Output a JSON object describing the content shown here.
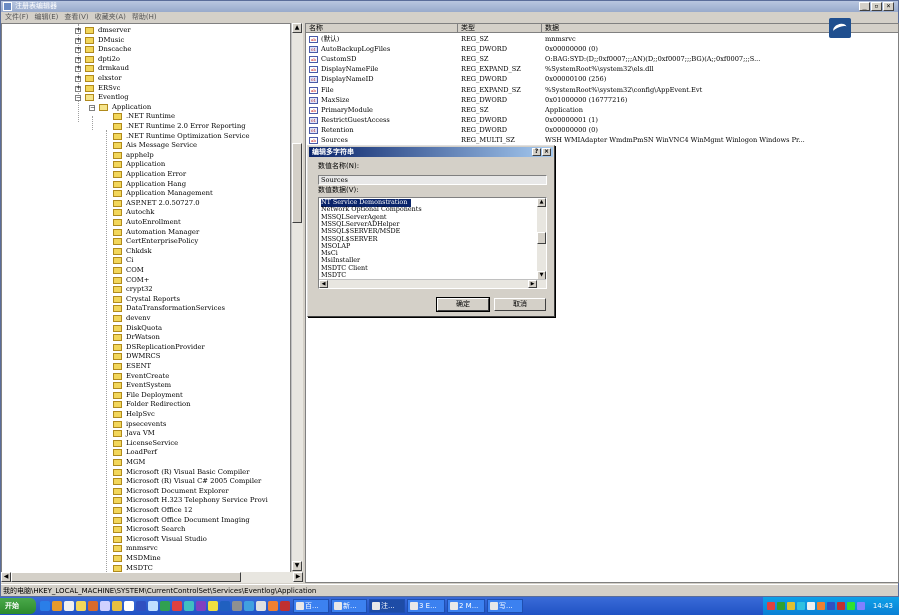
{
  "window": {
    "title": "注册表编辑器",
    "controls": [
      "_",
      "▫",
      "×"
    ]
  },
  "menu": [
    "文件(F)",
    "编辑(E)",
    "查看(V)",
    "收藏夹(A)",
    "帮助(H)"
  ],
  "tree": {
    "top_items": [
      {
        "label": "dmserver",
        "expand": "+"
      },
      {
        "label": "DMusic",
        "expand": "+"
      },
      {
        "label": "Dnscache",
        "expand": "+"
      },
      {
        "label": "dpti2o",
        "expand": "+"
      },
      {
        "label": "drmkaud",
        "expand": "+"
      },
      {
        "label": "elxstor",
        "expand": "+"
      },
      {
        "label": "ERSvc",
        "expand": "+"
      },
      {
        "label": "Eventlog",
        "expand": "−"
      }
    ],
    "application": {
      "label": "Application",
      "expand": "−"
    },
    "children": [
      ".NET Runtime",
      ".NET Runtime 2.0 Error Reporting",
      ".NET Runtime Optimization Service",
      "Ais Message Service",
      "apphelp",
      "Application",
      "Application Error",
      "Application Hang",
      "Application Management",
      "ASP.NET 2.0.50727.0",
      "Autochk",
      "AutoEnrollment",
      "Automation Manager",
      "CertEnterprisePolicy",
      "Chkdsk",
      "Ci",
      "COM",
      "COM+",
      "crypt32",
      "Crystal Reports",
      "DataTransformationServices",
      "devenv",
      "DiskQuota",
      "DrWatson",
      "DSReplicationProvider",
      "DWMRCS",
      "ESENT",
      "EventCreate",
      "EventSystem",
      "File Deployment",
      "Folder Redirection",
      "HelpSvc",
      "ipsecevents",
      "Java VM",
      "LicenseService",
      "LoadPerf",
      "MGM",
      "Microsoft (R) Visual Basic Compiler",
      "Microsoft (R) Visual C# 2005 Compiler",
      "Microsoft Document Explorer",
      "Microsoft H.323 Telephony Service Provi",
      "Microsoft Office 12",
      "Microsoft Office Document Imaging",
      "Microsoft Search",
      "Microsoft Visual Studio",
      "mnmsrvc",
      "MSDMine",
      "MSDTC"
    ]
  },
  "list": {
    "columns": [
      "名称",
      "类型",
      "数据"
    ],
    "rows": [
      {
        "icon": "ab",
        "name": "(默认)",
        "type": "REG_SZ",
        "data": "mnmsrvc"
      },
      {
        "icon": "bin",
        "name": "AutoBackupLogFiles",
        "type": "REG_DWORD",
        "data": "0x00000000 (0)"
      },
      {
        "icon": "ab",
        "name": "CustomSD",
        "type": "REG_SZ",
        "data": "O:BAG:SYD:(D;;0xf0007;;;AN)(D;;0xf0007;;;BG)(A;;0xf0007;;;S..."
      },
      {
        "icon": "ab",
        "name": "DisplayNameFile",
        "type": "REG_EXPAND_SZ",
        "data": "%SystemRoot%\\system32\\els.dll"
      },
      {
        "icon": "bin",
        "name": "DisplayNameID",
        "type": "REG_DWORD",
        "data": "0x00000100 (256)"
      },
      {
        "icon": "ab",
        "name": "File",
        "type": "REG_EXPAND_SZ",
        "data": "%SystemRoot%\\system32\\config\\AppEvent.Evt"
      },
      {
        "icon": "bin",
        "name": "MaxSize",
        "type": "REG_DWORD",
        "data": "0x01000000 (16777216)"
      },
      {
        "icon": "ab",
        "name": "PrimaryModule",
        "type": "REG_SZ",
        "data": "Application"
      },
      {
        "icon": "bin",
        "name": "RestrictGuestAccess",
        "type": "REG_DWORD",
        "data": "0x00000001 (1)"
      },
      {
        "icon": "bin",
        "name": "Retention",
        "type": "REG_DWORD",
        "data": "0x00000000 (0)"
      },
      {
        "icon": "ab",
        "name": "Sources",
        "type": "REG_MULTI_SZ",
        "data": "WSH WMIAdapter WmdmPmSN WinVNC4 WinMgmt Winlogon Windows Pr..."
      }
    ]
  },
  "dialog": {
    "title": "编辑多字符串",
    "help_btn": "?",
    "close_btn": "×",
    "name_label": "数值名称(N):",
    "name_value": "Sources",
    "data_label": "数值数据(V):",
    "lines": [
      "NT Service Demonstration",
      "Network Optional Components",
      "MSSQLServerAgent",
      "MSSQLServerADHelper",
      "MSSQL$SERVER/MSDE",
      "MSSQL$SERVER",
      "MSOLAP",
      "MsCi",
      "MsiInstaller",
      "MSDTC Client",
      "MSDTC"
    ],
    "ok": "确定",
    "cancel": "取消"
  },
  "statusbar": "我的电脑\\HKEY_LOCAL_MACHINE\\SYSTEM\\CurrentControlSet\\Services\\Eventlog\\Application",
  "taskbar": {
    "start": "开始",
    "tasks": [
      "百...",
      "新...",
      "注...",
      "3 E...",
      "2 M...",
      "写..."
    ],
    "clock": "14:43"
  },
  "colors": {
    "title_active": "#0a246a",
    "taskbar": "#2052c4",
    "tray": "#0a7fd4",
    "start": "#2b8a2b"
  }
}
